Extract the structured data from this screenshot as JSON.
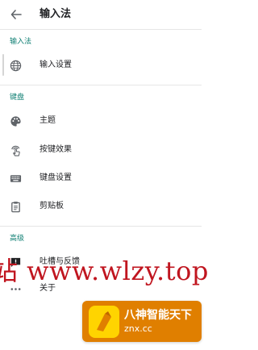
{
  "appbar": {
    "title": "输入法"
  },
  "sections": {
    "ime": "输入法",
    "keyboard": "键盘",
    "advanced": "高级"
  },
  "items": {
    "input_settings": "输入设置",
    "theme": "主题",
    "key_effects": "按键效果",
    "keyboard_settings": "键盘设置",
    "clipboard": "剪贴板",
    "feedback": "吐槽与反馈",
    "about": "关于"
  },
  "watermark": {
    "text": "站 www.wlzy.top",
    "badge_title": "八神智能天下",
    "badge_url": "znx.cc"
  },
  "colors": {
    "accent": "#0f7f73",
    "watermark": "#c0151f",
    "badge": "#e07f00"
  }
}
